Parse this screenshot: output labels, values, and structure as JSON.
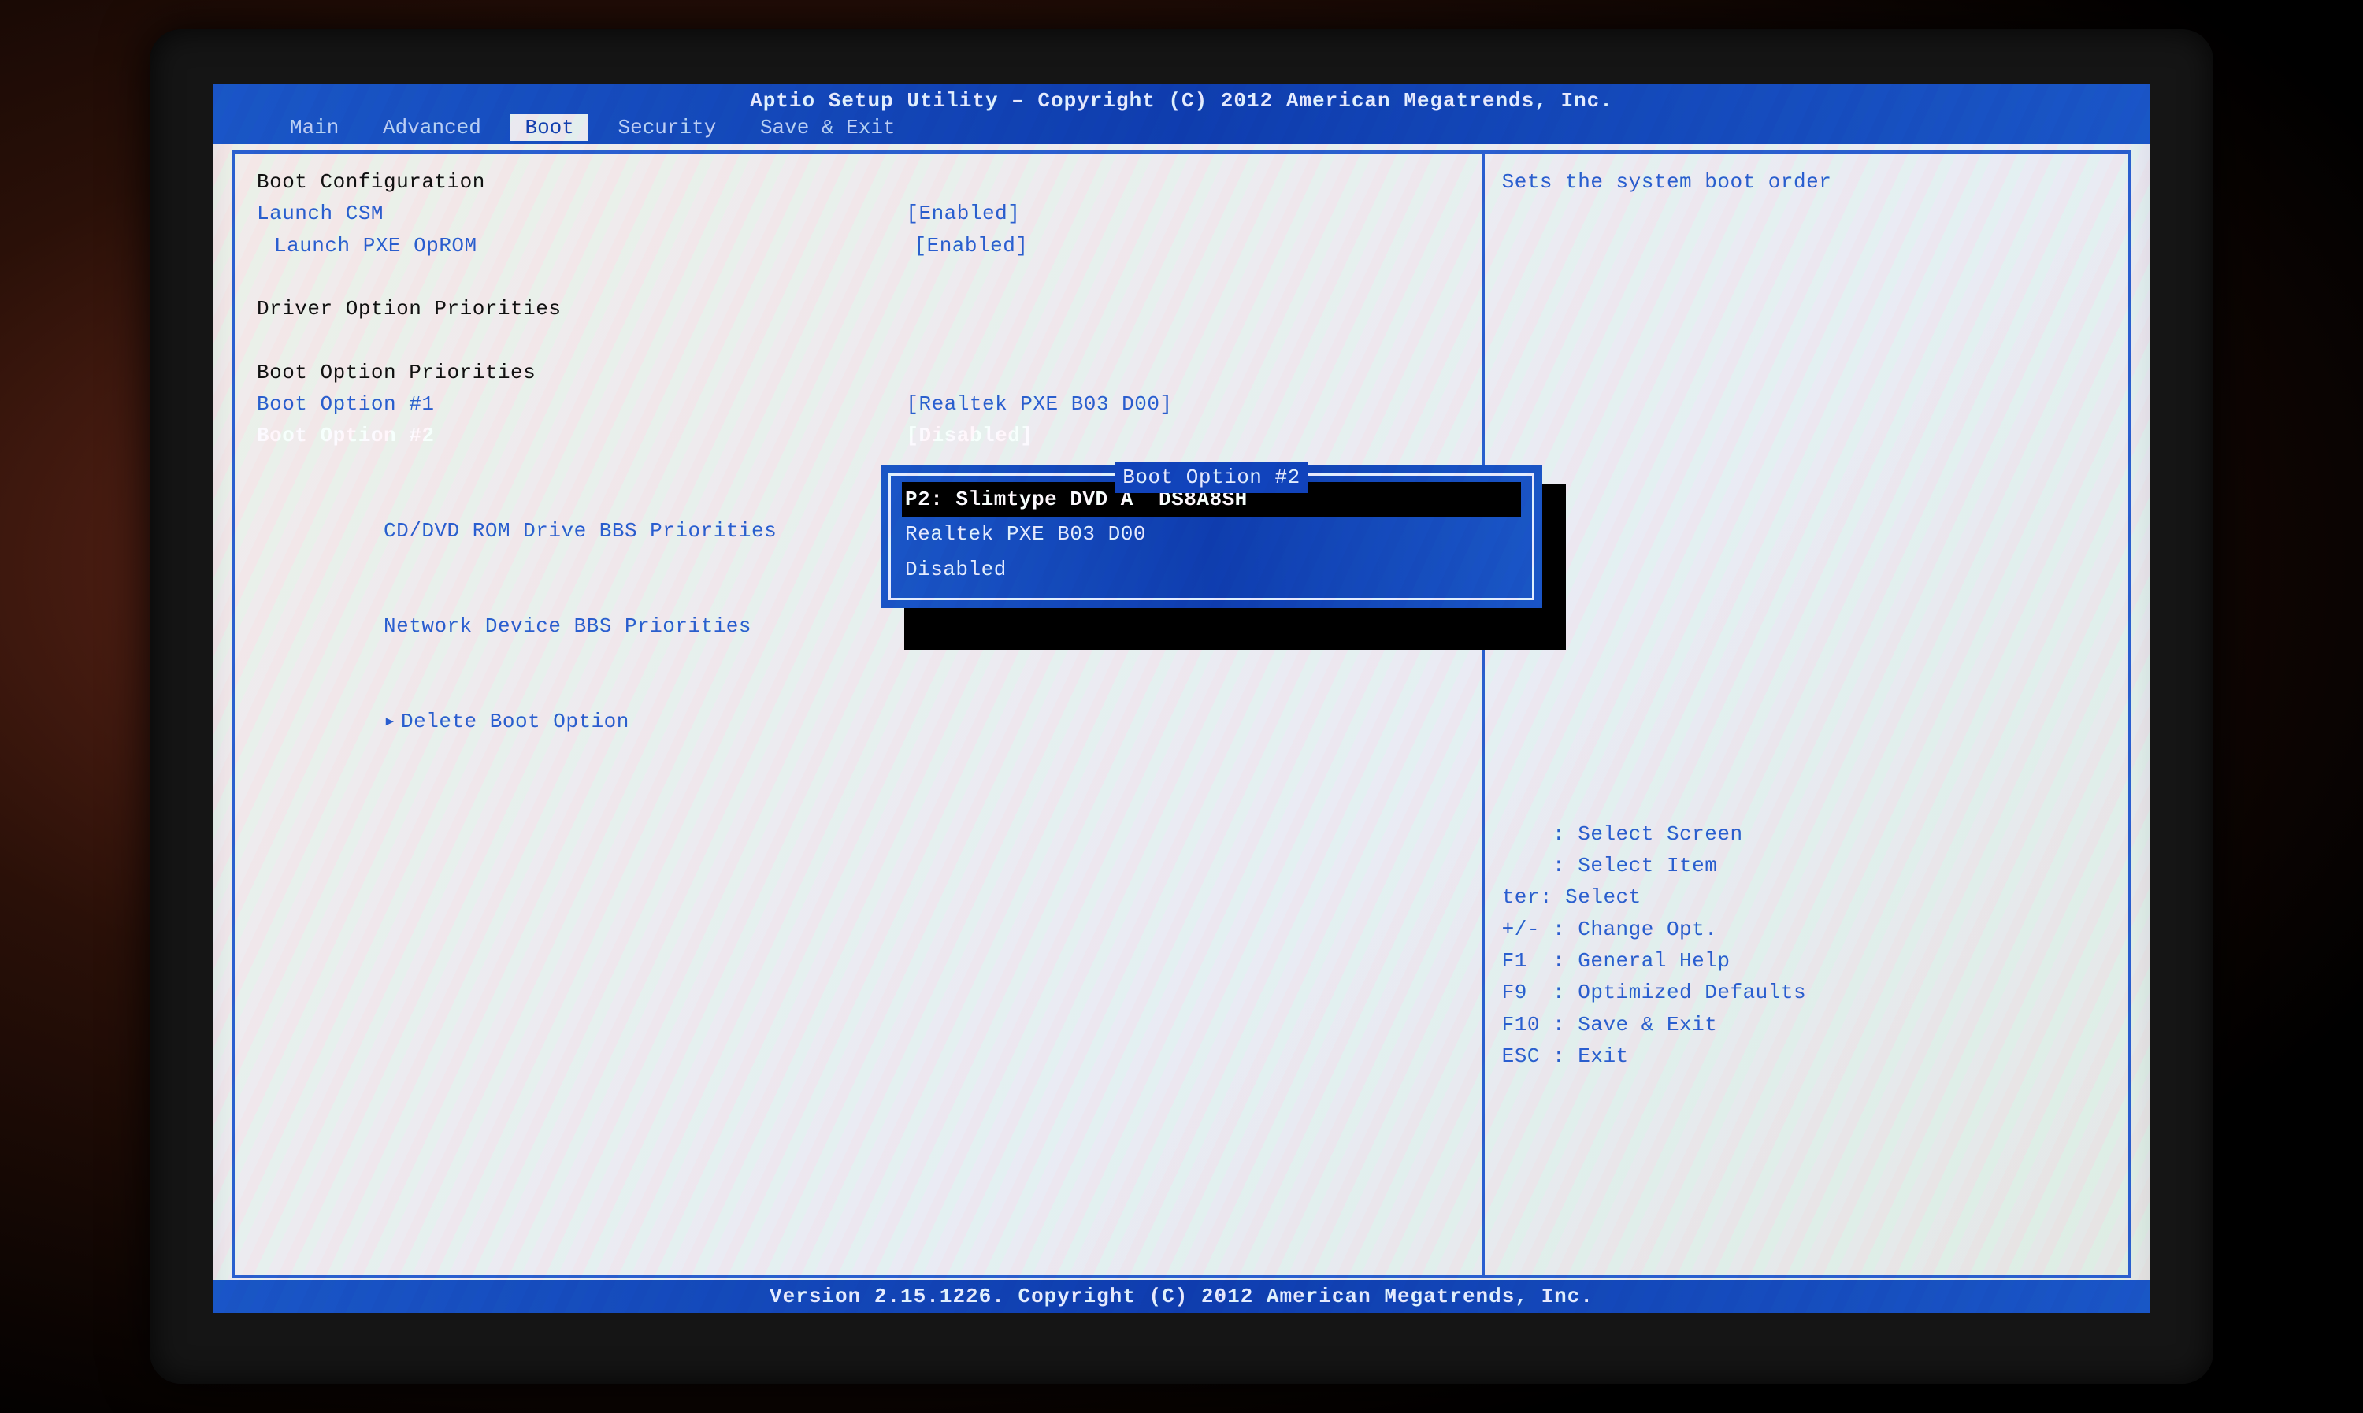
{
  "header": {
    "title": "Aptio Setup Utility – Copyright (C) 2012 American Megatrends, Inc."
  },
  "tabs": {
    "items": [
      "Main",
      "Advanced",
      "Boot",
      "Security",
      "Save & Exit"
    ],
    "active_index": 2
  },
  "left": {
    "section1_title": "Boot Configuration",
    "launch_csm_label": "Launch CSM",
    "launch_csm_value": "[Enabled]",
    "launch_pxe_label": "Launch PXE OpROM",
    "launch_pxe_value": "[Enabled]",
    "section2_title": "Driver Option Priorities",
    "section3_title": "Boot Option Priorities",
    "boot1_label": "Boot Option #1",
    "boot1_value": "[Realtek PXE B03 D00]",
    "boot2_label": "Boot Option #2",
    "boot2_value": "[Disabled]",
    "cddvd_label": "CD/DVD ROM Drive BBS Priorities",
    "netdev_label": "Network Device BBS Priorities",
    "delete_label": "Delete Boot Option"
  },
  "right": {
    "help_text": "Sets the system boot order",
    "keys": {
      "k0": "    : Select Screen",
      "k1": "    : Select Item",
      "k2": "ter: Select",
      "k3": "+/- : Change Opt.",
      "k4": "F1  : General Help",
      "k5": "F9  : Optimized Defaults",
      "k6": "F10 : Save & Exit",
      "k7": "ESC : Exit"
    }
  },
  "popup": {
    "title": " Boot Option #2 ",
    "items": [
      "P2: Slimtype DVD A  DS8A8SH",
      "Realtek PXE B03 D00",
      "Disabled"
    ],
    "selected_index": 0
  },
  "footer": {
    "text": "Version 2.15.1226. Copyright (C) 2012 American Megatrends, Inc."
  }
}
